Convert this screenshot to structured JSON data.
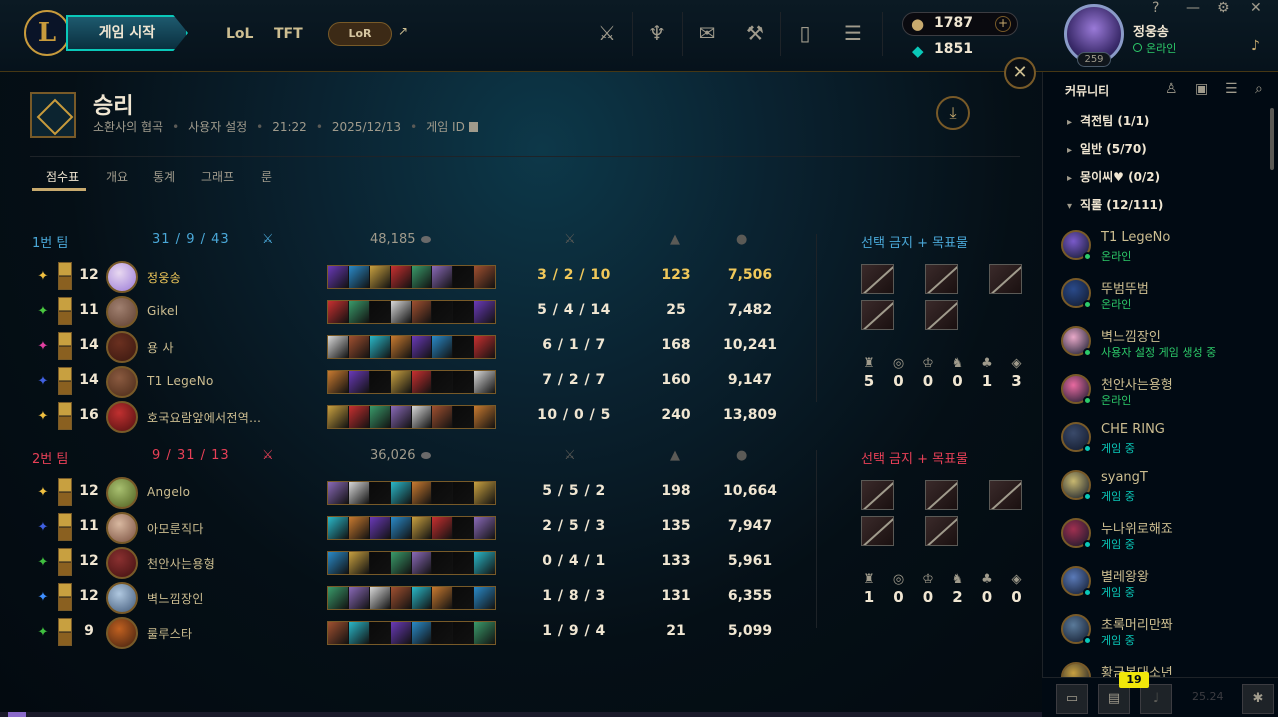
{
  "topbar": {
    "logo": "L",
    "play_label": "게임 시작",
    "nav": [
      "LoL",
      "TFT"
    ],
    "lor_label": "LoR",
    "ext_icon": "↗",
    "icons": [
      "worlds-icon",
      "trophy-icon",
      "store-icon",
      "loot-icon",
      "collection-icon",
      "currency-icon"
    ],
    "rp_value": "1787",
    "be_value": "1851",
    "rp_plus": "+",
    "profile": {
      "name": "정웅송",
      "status": "온라인",
      "level": "259"
    },
    "window_buttons": [
      "?",
      "—",
      "⚙",
      "✕"
    ]
  },
  "match": {
    "close_icon": "✕",
    "result": "승리",
    "meta": {
      "mode": "소환사의 협곡",
      "type": "사용자 설정",
      "duration": "21:22",
      "date": "2025/12/13",
      "game_id_label": "게임 ID"
    },
    "tabs": [
      "점수표",
      "개요",
      "통계",
      "그래프",
      "룬"
    ],
    "team1": {
      "name": "1번 팀",
      "kills": "31",
      "deaths": "9",
      "assists": "43",
      "gold": "48,185",
      "bans_title": "선택 금지 + 목표물",
      "objectives": [
        "5",
        "0",
        "0",
        "0",
        "1",
        "3"
      ],
      "players": [
        {
          "level": "12",
          "summoner": "정웅송",
          "kda": "3 / 2 / 10",
          "cs": "123",
          "gold": "7,506",
          "me": true
        },
        {
          "level": "11",
          "summoner": "Gikel",
          "kda": "5 / 4 / 14",
          "cs": "25",
          "gold": "7,482",
          "me": false
        },
        {
          "level": "14",
          "summoner": "용 사",
          "kda": "6 / 1 / 7",
          "cs": "168",
          "gold": "10,241",
          "me": false
        },
        {
          "level": "14",
          "summoner": "T1 LegeNo",
          "kda": "7 / 2 / 7",
          "cs": "160",
          "gold": "9,147",
          "me": false
        },
        {
          "level": "16",
          "summoner": "호국요람앞에서전역…",
          "kda": "10 / 0 / 5",
          "cs": "240",
          "gold": "13,809",
          "me": false
        }
      ]
    },
    "team2": {
      "name": "2번 팀",
      "kills": "9",
      "deaths": "31",
      "assists": "13",
      "gold": "36,026",
      "bans_title": "선택 금지 + 목표물",
      "objectives": [
        "1",
        "0",
        "0",
        "2",
        "0",
        "0"
      ],
      "players": [
        {
          "level": "12",
          "summoner": "Angelo",
          "kda": "5 / 5 / 2",
          "cs": "198",
          "gold": "10,664",
          "me": false
        },
        {
          "level": "11",
          "summoner": "아모룬직다",
          "kda": "2 / 5 / 3",
          "cs": "135",
          "gold": "7,947",
          "me": false
        },
        {
          "level": "12",
          "summoner": "천안사는용형",
          "kda": "0 / 4 / 1",
          "cs": "133",
          "gold": "5,961",
          "me": false
        },
        {
          "level": "12",
          "summoner": "벽느낌장인",
          "kda": "1 / 8 / 3",
          "cs": "131",
          "gold": "6,355",
          "me": false
        },
        {
          "level": "9",
          "summoner": "룰루스타",
          "kda": "1 / 9 / 4",
          "cs": "21",
          "gold": "5,099",
          "me": false
        }
      ]
    }
  },
  "social": {
    "title": "커뮤니티",
    "groups": [
      {
        "arrow": "▸",
        "label": "격전팀 (1/1)"
      },
      {
        "arrow": "▸",
        "label": "일반 (5/70)"
      },
      {
        "arrow": "▸",
        "label": "몽이씨♥ (0/2)"
      },
      {
        "arrow": "▾",
        "label": "직롤 (12/111)"
      }
    ],
    "friends": [
      {
        "name": "T1 LegeNo",
        "status": "온라인",
        "color": "#2dcb6a"
      },
      {
        "name": "뚜범뚜범",
        "status": "온라인",
        "color": "#2dcb6a"
      },
      {
        "name": "벽느낌장인",
        "status": "사용자 설정 게임 생성 중",
        "color": "#2dcb6a"
      },
      {
        "name": "천안사는용형",
        "status": "온라인",
        "color": "#2dcb6a"
      },
      {
        "name": "CHE RING",
        "status": "게임 중",
        "color": "#0ac8b9"
      },
      {
        "name": "syangT",
        "status": "게임 중",
        "color": "#0ac8b9"
      },
      {
        "name": "누나위로해죠",
        "status": "게임 중",
        "color": "#0ac8b9"
      },
      {
        "name": "별레왕왕",
        "status": "게임 중",
        "color": "#0ac8b9"
      },
      {
        "name": "초록머리만쫘",
        "status": "게임 중",
        "color": "#0ac8b9"
      },
      {
        "name": "황금봉대소년",
        "status": "",
        "color": "#0ac8b9"
      }
    ],
    "badge": "19",
    "version": "25.24"
  },
  "colors": {
    "gold": "#c8aa6e",
    "accent": "#0ac8b9",
    "blue_team": "#4aa8d8",
    "red_team": "#e84057",
    "online": "#2dcb6a"
  }
}
